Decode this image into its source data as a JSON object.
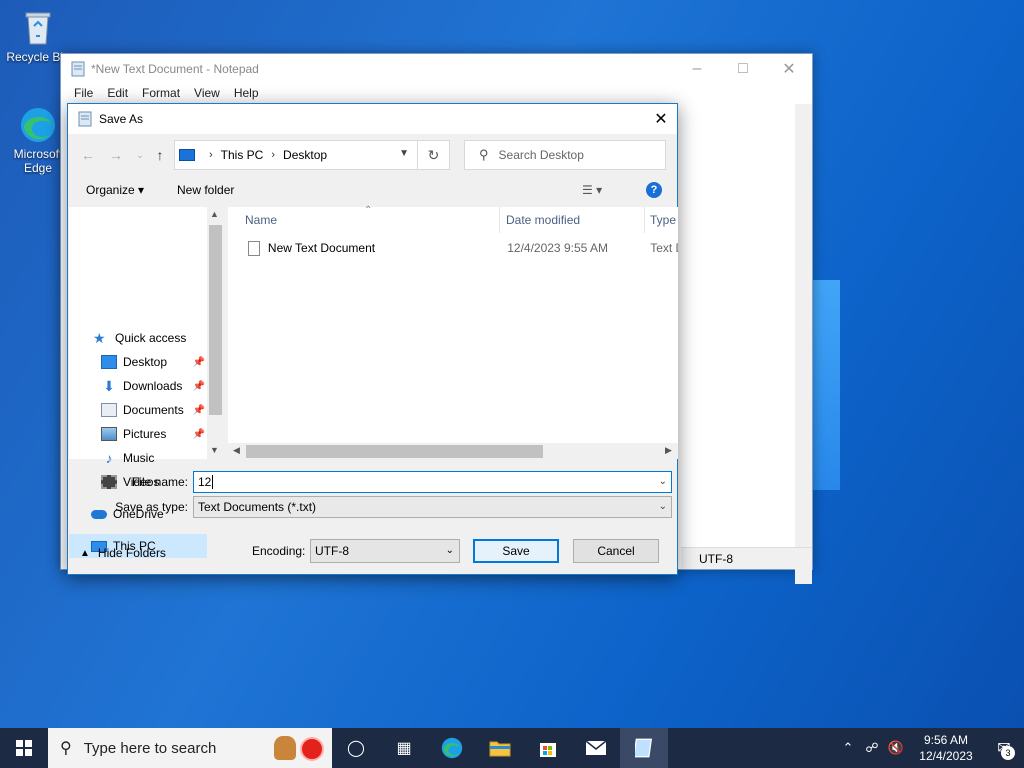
{
  "desktop": {
    "icons": [
      {
        "label": "Recycle Bin",
        "icon": "recycle-bin-icon"
      },
      {
        "label": "Microsoft Edge",
        "icon": "edge-icon"
      }
    ]
  },
  "notepad": {
    "title": "*New Text Document - Notepad",
    "menu": [
      "File",
      "Edit",
      "Format",
      "View",
      "Help"
    ],
    "status_encoding": "UTF-8"
  },
  "dialog": {
    "title": "Save As",
    "breadcrumb": [
      "This PC",
      "Desktop"
    ],
    "search_placeholder": "Search Desktop",
    "organize_label": "Organize",
    "new_folder_label": "New folder",
    "nav": [
      {
        "label": "Quick access",
        "icon": "star-icon"
      },
      {
        "label": "Desktop",
        "icon": "desktop-folder-icon",
        "pinned": true
      },
      {
        "label": "Downloads",
        "icon": "downloads-icon",
        "pinned": true
      },
      {
        "label": "Documents",
        "icon": "documents-icon",
        "pinned": true
      },
      {
        "label": "Pictures",
        "icon": "pictures-icon",
        "pinned": true
      },
      {
        "label": "Music",
        "icon": "music-icon"
      },
      {
        "label": "Videos",
        "icon": "videos-icon"
      },
      {
        "label": "OneDrive",
        "icon": "onedrive-icon"
      },
      {
        "label": "This PC",
        "icon": "this-pc-icon",
        "selected": true
      }
    ],
    "columns": [
      "Name",
      "Date modified",
      "Type"
    ],
    "files": [
      {
        "name": "New Text Document",
        "modified": "12/4/2023 9:55 AM",
        "type": "Text D"
      }
    ],
    "file_name_label": "File name:",
    "file_name_value": "12",
    "save_type_label": "Save as type:",
    "save_type_value": "Text Documents (*.txt)",
    "hide_folders_label": "Hide Folders",
    "encoding_label": "Encoding:",
    "encoding_value": "UTF-8",
    "save_label": "Save",
    "cancel_label": "Cancel"
  },
  "taskbar": {
    "search_placeholder": "Type here to search",
    "time": "9:56 AM",
    "date": "12/4/2023",
    "notification_count": "3"
  },
  "colors": {
    "accent": "#0078d7",
    "selection": "#cce8ff",
    "taskbar": "#1c2a44"
  }
}
